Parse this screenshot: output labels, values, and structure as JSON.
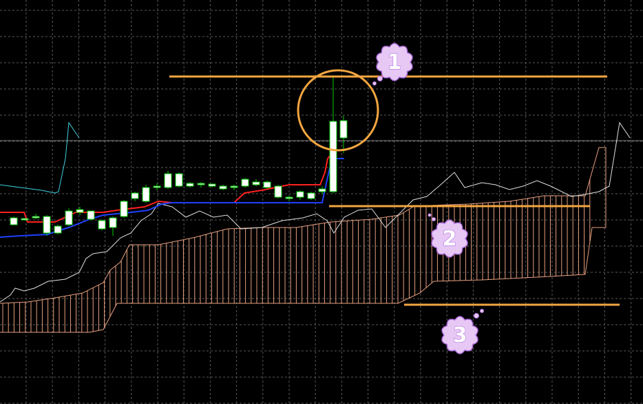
{
  "chart_data": {
    "type": "candlestick-ichimoku",
    "colors": {
      "background": "#000000",
      "grid": "#5a5a5a",
      "bull_body": "#ffffff",
      "candle_outline": "#00cc00",
      "tenkan": "#ff2020",
      "kijun": "#2040ff",
      "chikou": "#e0e0e0",
      "cloud": "#e8a080",
      "level": "#f4a640",
      "bubble_fill": "#e7c8f5",
      "bubble_stroke": "#b070e0",
      "cursor_line": "#d0d0d0"
    },
    "annotations": [
      {
        "label": "1"
      },
      {
        "label": "2"
      },
      {
        "label": "3"
      }
    ]
  }
}
